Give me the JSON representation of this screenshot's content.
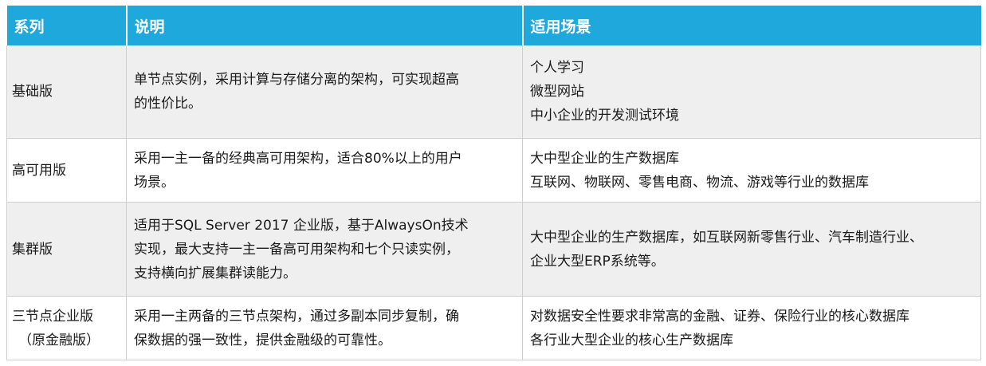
{
  "table": {
    "headers": [
      "系列",
      "说明",
      "适用场景"
    ],
    "rows": [
      {
        "series": [
          "基础版"
        ],
        "description": [
          "单节点实例，采用计算与存储分离的架构，可实现超高",
          "的性价比。"
        ],
        "scenarios": [
          "个人学习",
          "微型网站",
          "中小企业的开发测试环境"
        ]
      },
      {
        "series": [
          "高可用版"
        ],
        "description": [
          "采用一主一备的经典高可用架构，适合80%以上的用户",
          "场景。"
        ],
        "scenarios": [
          "大中型企业的生产数据库",
          "互联网、物联网、零售电商、物流、游戏等行业的数据库"
        ]
      },
      {
        "series": [
          "集群版"
        ],
        "description": [
          "适用于SQL Server 2017 企业版，基于AlwaysOn技术",
          "实现，最大支持一主一备高可用架构和七个只读实例，",
          "支持横向扩展集群读能力。"
        ],
        "scenarios": [
          "大中型企业的生产数据库，如互联网新零售行业、汽车制造行业、",
          "企业大型ERP系统等。"
        ]
      },
      {
        "series": [
          "三节点企业版",
          "（原金融版）"
        ],
        "description": [
          "采用一主两备的三节点架构，通过多副本同步复制，确",
          "保数据的强一致性，提供金融级的可靠性。"
        ],
        "scenarios": [
          "对数据安全性要求非常高的金融、证券、保险行业的核心数据库",
          "各行业大型企业的核心生产数据库"
        ]
      }
    ]
  },
  "colors": {
    "header_bg": "#1fa8dc",
    "header_text": "#ffffff",
    "row_alt_bg": "#efefef",
    "border": "#cfcfcf"
  }
}
